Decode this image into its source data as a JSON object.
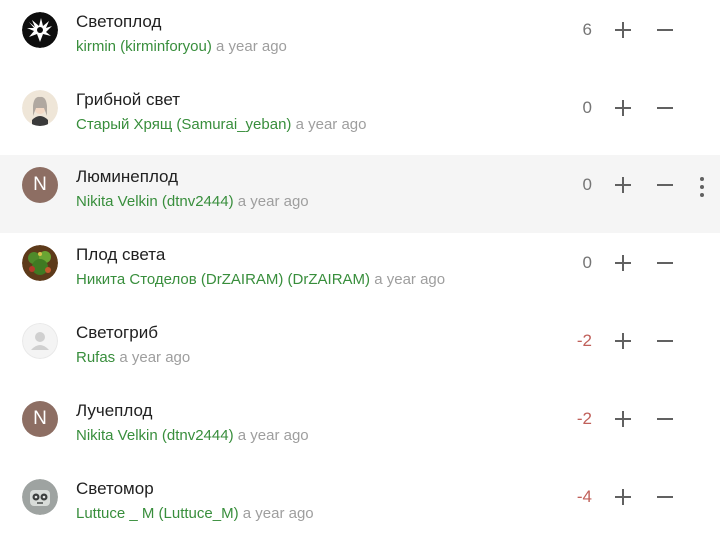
{
  "suggestions": [
    {
      "title": "Светоплод",
      "author": "kirmin (kirminforyou)",
      "time": "a year ago",
      "score": "6",
      "avatar": "wolf-avatar"
    },
    {
      "title": "Грибной свет",
      "author": "Старый Хрящ (Samurai_yeban)",
      "time": "a year ago",
      "score": "0",
      "avatar": "character-avatar"
    },
    {
      "title": "Люминеплод",
      "author": "Nikita Velkin (dtnv2444)",
      "time": "a year ago",
      "score": "0",
      "avatar": "letter-avatar",
      "avatar_letter": "N"
    },
    {
      "title": "Плод света",
      "author": "Никита Стоделов (DrZAIRAM) (DrZAIRAM)",
      "time": "a year ago",
      "score": "0",
      "avatar": "plant-avatar"
    },
    {
      "title": "Светогриб",
      "author": "Rufas",
      "time": "a year ago",
      "score": "-2",
      "avatar": "default-user-avatar"
    },
    {
      "title": "Лучеплод",
      "author": "Nikita Velkin (dtnv2444)",
      "time": "a year ago",
      "score": "-2",
      "avatar": "letter-avatar",
      "avatar_letter": "N"
    },
    {
      "title": "Светомор",
      "author": "Luttuce _ M (Luttuce_M)",
      "time": "a year ago",
      "score": "-4",
      "avatar": "robot-avatar"
    }
  ],
  "colors": {
    "author": "#388e3c",
    "time": "#9e9e9e",
    "negative_score": "#c0605a",
    "neutral_score": "#757575",
    "highlight_row": "#f5f5f5",
    "letter_avatar": "#8d6e63"
  },
  "icons": {
    "upvote": "plus-icon",
    "downvote": "minus-icon",
    "more": "more-vertical-icon"
  }
}
